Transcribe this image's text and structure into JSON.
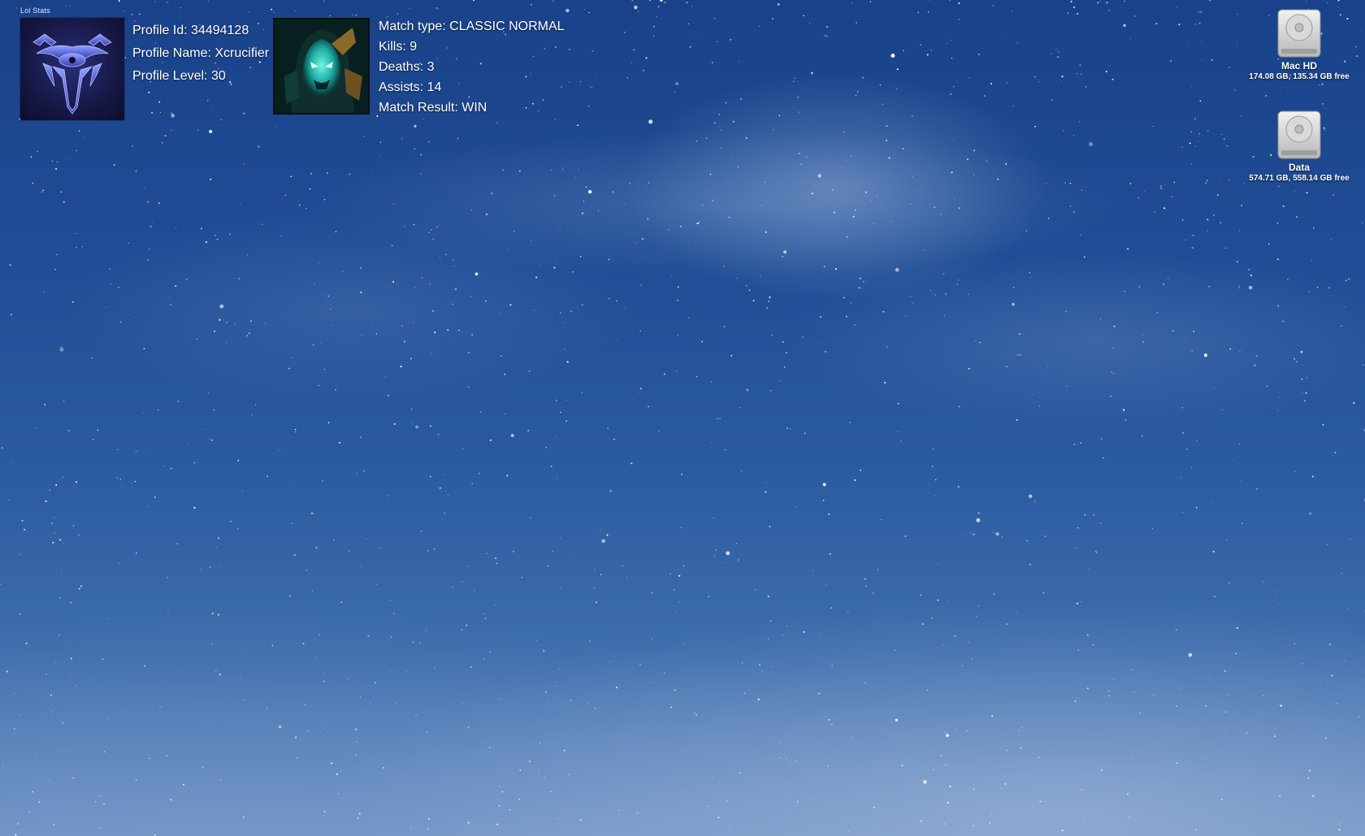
{
  "widget": {
    "title": "Lol Stats",
    "profile": {
      "icon": "profile-emblem-icon",
      "id_line": "Profile Id: 34494128",
      "name_line": "Profile Name: Xcrucifier",
      "level_line": "Profile Level: 30"
    },
    "match": {
      "champion_icon": "champion-portrait-icon",
      "type_line": "Match type: CLASSIC NORMAL",
      "kills_line": "Kills: 9",
      "deaths_line": "Deaths: 3",
      "assists_line": "Assists: 14",
      "result_line": "Match Result: WIN"
    }
  },
  "desktop": {
    "wallpaper": "starry-night-milky-way",
    "drives": [
      {
        "icon": "hard-drive-icon",
        "name": "Mac HD",
        "capacity": "174.08 GB, 135.34 GB free"
      },
      {
        "icon": "hard-drive-icon",
        "name": "Data",
        "capacity": "574.71 GB, 558.14 GB free"
      }
    ]
  },
  "colors": {
    "sky_top": "#19428a",
    "sky_bottom": "#6b8fc2",
    "text": "#ffffff"
  }
}
